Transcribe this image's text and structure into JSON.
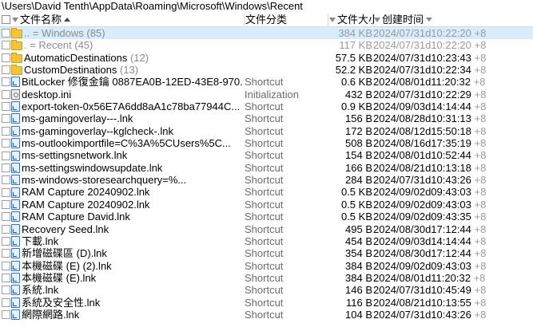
{
  "path": "\\Users\\David Tenth\\AppData\\Roaming\\Microsoft\\Windows\\Recent",
  "columns": {
    "name": "文件名称",
    "type": "文件分类",
    "size": "文件大小",
    "date": "创建时间"
  },
  "rows": [
    {
      "icon": "folder",
      "name": "..  =  Windows",
      "count": "(85)",
      "type": "",
      "size": "384 KB",
      "date": "2024/07/31d10:22:20",
      "suffix": "+8",
      "style": "sel dim"
    },
    {
      "icon": "folder",
      "name": ".  =  Recent",
      "count": "(45)",
      "type": "",
      "size": "117 KB",
      "date": "2024/07/31d10:22:20",
      "suffix": "+8",
      "style": "dim"
    },
    {
      "icon": "folder",
      "name": "AutomaticDestinations",
      "count": "(12)",
      "type": "",
      "size": "57.5 KB",
      "date": "2024/07/31d10:23:43",
      "suffix": "+8",
      "style": ""
    },
    {
      "icon": "folder",
      "name": "CustomDestinations",
      "count": "(13)",
      "type": "",
      "size": "52.2 KB",
      "date": "2024/07/31d10:22:34",
      "suffix": "+8",
      "style": ""
    },
    {
      "icon": "lnk",
      "name": "BitLocker 修復金鑰 0887EA0B-12ED-43E8-970...",
      "count": "",
      "type": "Shortcut",
      "size": "0.6 KB",
      "date": "2024/08/01d11:20:32",
      "suffix": "+8",
      "style": ""
    },
    {
      "icon": "ini",
      "name": "desktop.ini",
      "count": "",
      "type": "Initialization",
      "size": "432 B",
      "date": "2024/07/31d10:22:29",
      "suffix": "+8",
      "style": ""
    },
    {
      "icon": "lnk",
      "name": "export-token-0x56E7A6dd8aA1c78ba77944C...",
      "count": "",
      "type": "Shortcut",
      "size": "0.9 KB",
      "date": "2024/09/03d14:14:44",
      "suffix": "+8",
      "style": ""
    },
    {
      "icon": "lnk",
      "name": "ms-gamingoverlay---.lnk",
      "count": "",
      "type": "Shortcut",
      "size": "156 B",
      "date": "2024/08/28d10:31:13",
      "suffix": "+8",
      "style": ""
    },
    {
      "icon": "lnk",
      "name": "ms-gamingoverlay--kglcheck-.lnk",
      "count": "",
      "type": "Shortcut",
      "size": "172 B",
      "date": "2024/08/12d15:50:18",
      "suffix": "+8",
      "style": ""
    },
    {
      "icon": "lnk",
      "name": "ms-outlookimportfile=C%3A%5CUsers%5C...",
      "count": "",
      "type": "Shortcut",
      "size": "508 B",
      "date": "2024/08/16d17:35:19",
      "suffix": "+8",
      "style": ""
    },
    {
      "icon": "lnk",
      "name": "ms-settingsnetwork.lnk",
      "count": "",
      "type": "Shortcut",
      "size": "154 B",
      "date": "2024/08/01d10:52:44",
      "suffix": "+8",
      "style": ""
    },
    {
      "icon": "lnk",
      "name": "ms-settingswindowsupdate.lnk",
      "count": "",
      "type": "Shortcut",
      "size": "166 B",
      "date": "2024/08/21d10:13:18",
      "suffix": "+8",
      "style": ""
    },
    {
      "icon": "lnk",
      "name": "ms-windows-storesearchquery=%...",
      "count": "",
      "type": "Shortcut",
      "size": "284 B",
      "date": "2024/07/31d10:43:26",
      "suffix": "+8",
      "style": ""
    },
    {
      "icon": "lnk",
      "name": "RAM Capture 20240902.lnk",
      "count": "",
      "type": "Shortcut",
      "size": "0.5 KB",
      "date": "2024/09/02d09:43:03",
      "suffix": "+8",
      "style": ""
    },
    {
      "icon": "lnk",
      "name": "RAM Capture 20240902.lnk",
      "count": "",
      "type": "Shortcut",
      "size": "0.5 KB",
      "date": "2024/09/02d09:43:03",
      "suffix": "+8",
      "style": ""
    },
    {
      "icon": "lnk",
      "name": "RAM Capture David.lnk",
      "count": "",
      "type": "Shortcut",
      "size": "0.5 KB",
      "date": "2024/09/02d09:43:35",
      "suffix": "+8",
      "style": ""
    },
    {
      "icon": "lnk",
      "name": "Recovery Seed.lnk",
      "count": "",
      "type": "Shortcut",
      "size": "495 B",
      "date": "2024/08/30d17:12:44",
      "suffix": "+8",
      "style": ""
    },
    {
      "icon": "lnk",
      "name": "下載.lnk",
      "count": "",
      "type": "Shortcut",
      "size": "454 B",
      "date": "2024/09/03d14:14:44",
      "suffix": "+8",
      "style": ""
    },
    {
      "icon": "lnk",
      "name": "新增磁碟區 (D).lnk",
      "count": "",
      "type": "Shortcut",
      "size": "354 B",
      "date": "2024/08/30d17:12:44",
      "suffix": "+8",
      "style": ""
    },
    {
      "icon": "lnk",
      "name": "本機磁碟 (E) (2).lnk",
      "count": "",
      "type": "Shortcut",
      "size": "384 B",
      "date": "2024/09/02d09:43:03",
      "suffix": "+8",
      "style": ""
    },
    {
      "icon": "lnk",
      "name": "本機磁碟 (E).lnk",
      "count": "",
      "type": "Shortcut",
      "size": "384 B",
      "date": "2024/08/01d11:20:32",
      "suffix": "+8",
      "style": ""
    },
    {
      "icon": "lnk",
      "name": "系統.lnk",
      "count": "",
      "type": "Shortcut",
      "size": "146 B",
      "date": "2024/07/31d10:45:49",
      "suffix": "+8",
      "style": ""
    },
    {
      "icon": "lnk",
      "name": "系統及安全性.lnk",
      "count": "",
      "type": "Shortcut",
      "size": "116 B",
      "date": "2024/08/21d10:13:55",
      "suffix": "+8",
      "style": ""
    },
    {
      "icon": "lnk",
      "name": "網際網路.lnk",
      "count": "",
      "type": "Shortcut",
      "size": "104 B",
      "date": "2024/07/31d10:43:26",
      "suffix": "+8",
      "style": ""
    }
  ]
}
